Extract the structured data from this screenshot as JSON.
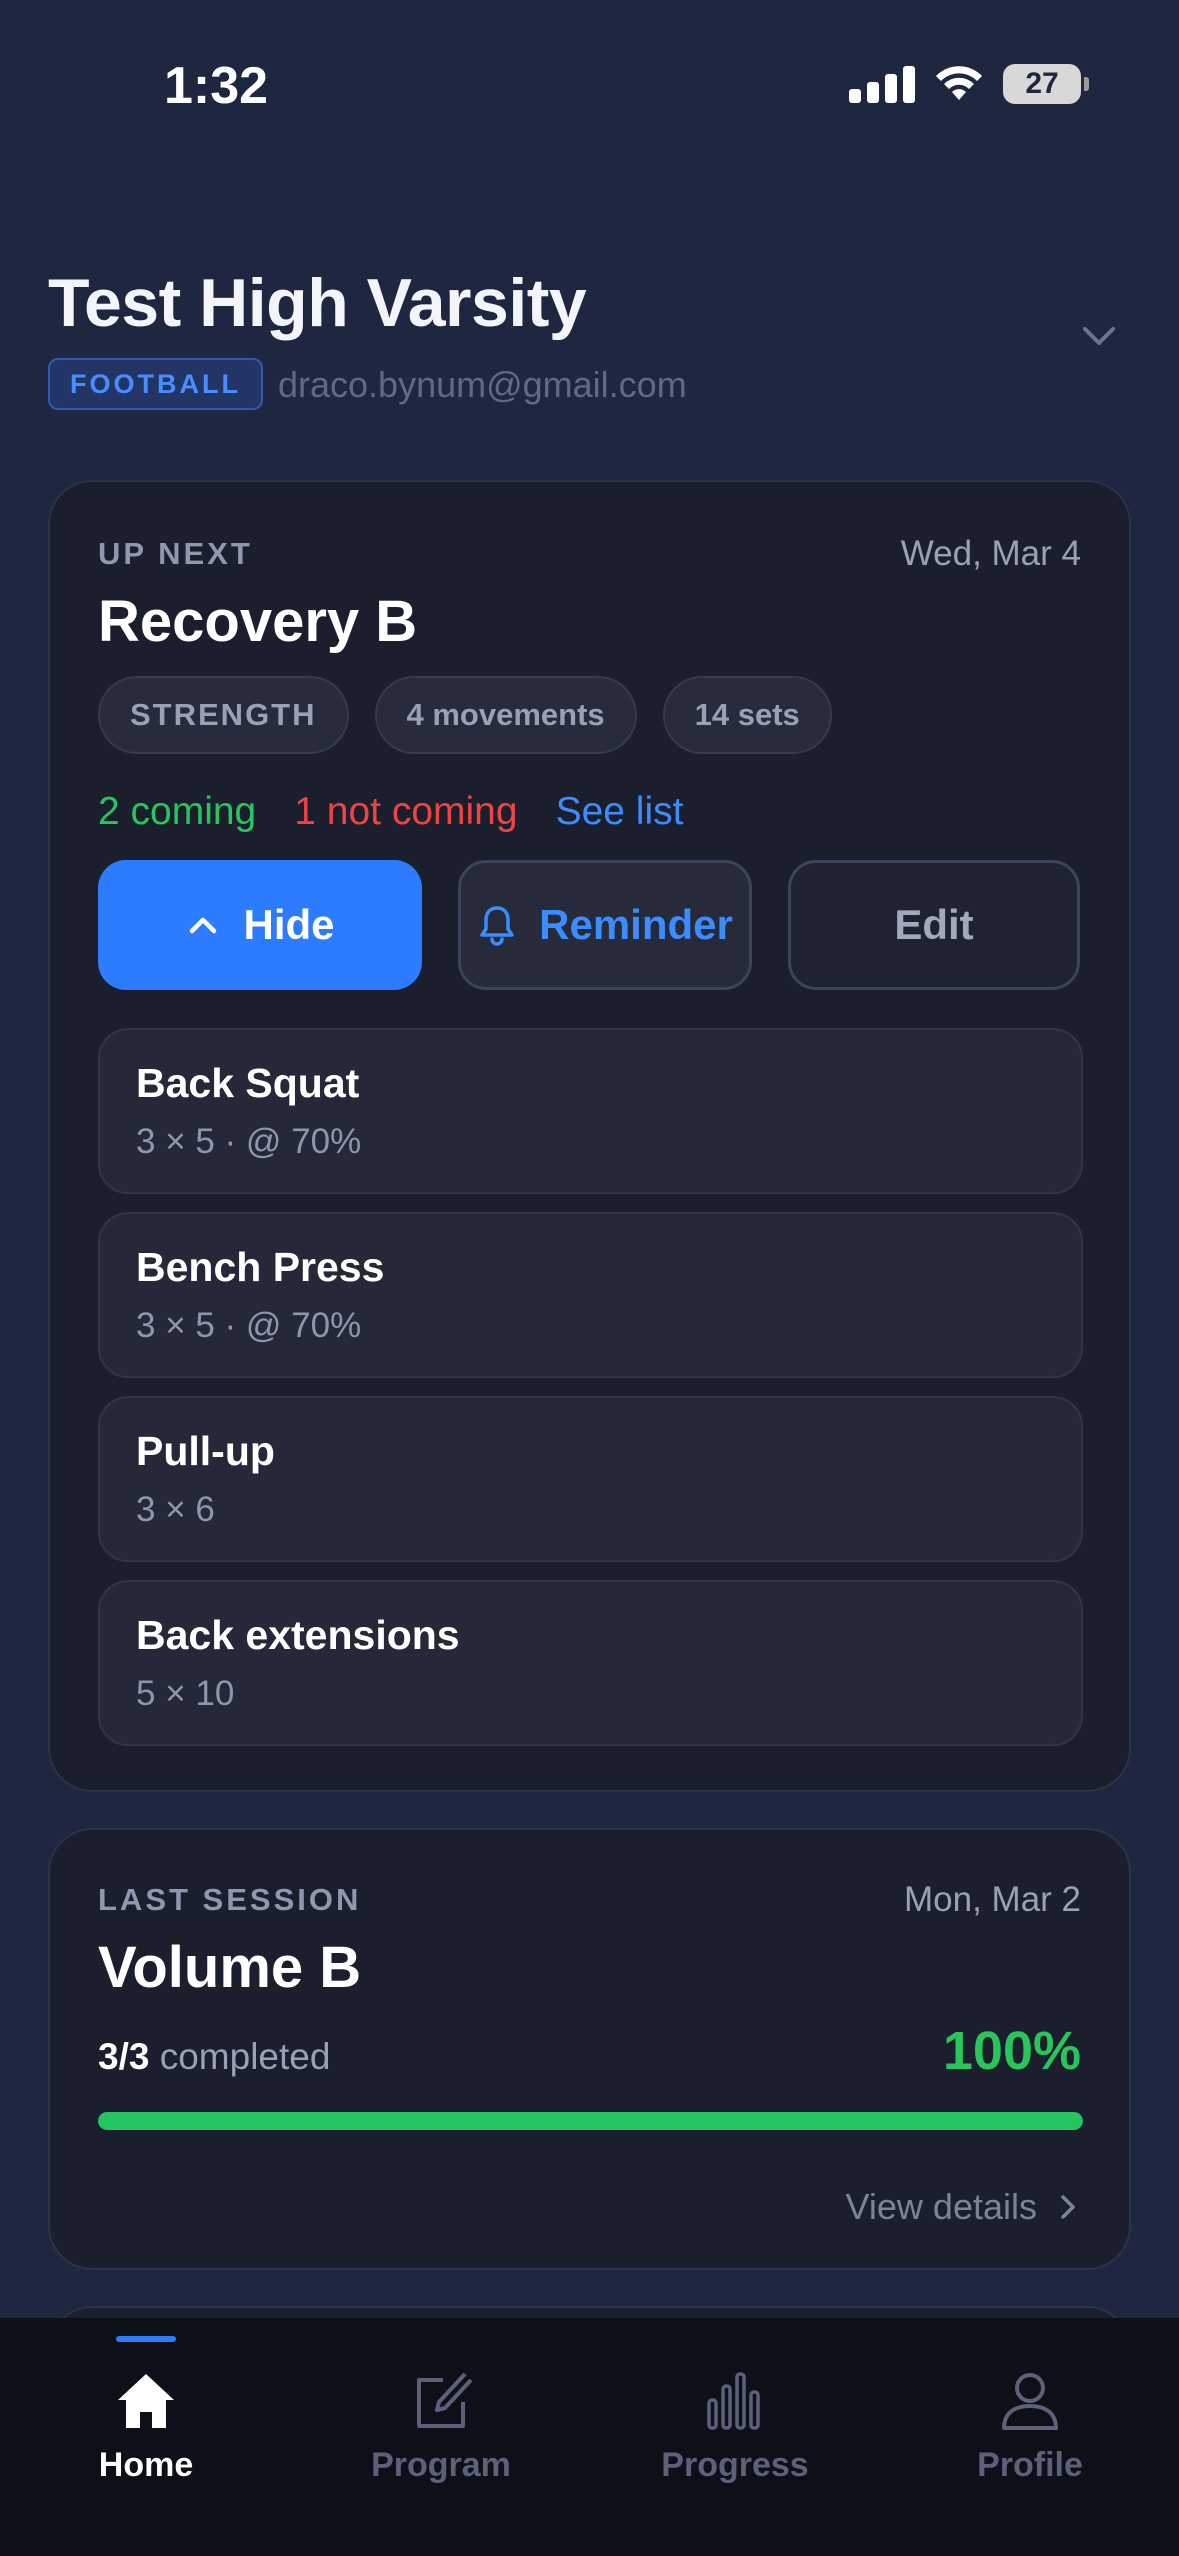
{
  "status_bar": {
    "time": "1:32",
    "battery": "27"
  },
  "header": {
    "team_name": "Test High Varsity",
    "sport": "FOOTBALL",
    "email": "draco.bynum@gmail.com"
  },
  "up_next": {
    "eyebrow": "UP NEXT",
    "date": "Wed, Mar 4",
    "title": "Recovery B",
    "chips": [
      "STRENGTH",
      "4 movements",
      "14 sets"
    ],
    "attendance": {
      "coming": "2 coming",
      "not_coming": "1 not coming",
      "see_list": "See list"
    },
    "actions": {
      "hide": "Hide",
      "reminder": "Reminder",
      "edit": "Edit"
    },
    "movements": [
      {
        "name": "Back Squat",
        "detail": "3 × 5 · @ 70%"
      },
      {
        "name": "Bench Press",
        "detail": "3 × 5 · @ 70%"
      },
      {
        "name": "Pull-up",
        "detail": "3 × 6"
      },
      {
        "name": "Back extensions",
        "detail": "5 × 10"
      }
    ]
  },
  "last_session": {
    "eyebrow": "LAST SESSION",
    "date": "Mon, Mar 2",
    "title": "Volume B",
    "completed_count": "3/3",
    "completed_label": "completed",
    "percent_text": "100%",
    "progress": 1.0,
    "view_details": "View details"
  },
  "tabs": [
    {
      "label": "Home",
      "icon": "home-icon",
      "active": true
    },
    {
      "label": "Program",
      "icon": "edit-icon",
      "active": false
    },
    {
      "label": "Progress",
      "icon": "bar-chart-icon",
      "active": false
    },
    {
      "label": "Profile",
      "icon": "user-icon",
      "active": false
    }
  ],
  "colors": {
    "accent": "#2d7bff",
    "success": "#22c55e",
    "danger": "#ef4444",
    "background": "#1f2640",
    "card": "#1b1e2c"
  }
}
